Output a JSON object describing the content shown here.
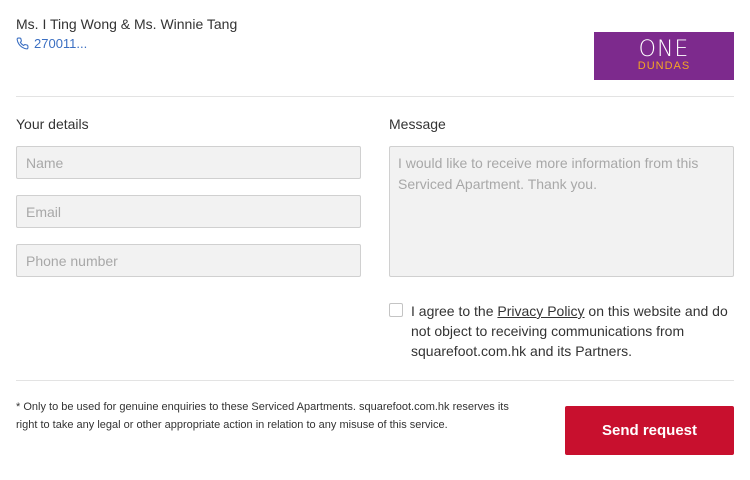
{
  "agent": {
    "name": "Ms. I Ting Wong & Ms. Winnie Tang",
    "phone": "270011..."
  },
  "logo": {
    "line1": "ONE",
    "line2": "DUNDAS",
    "bg_color": "#7d2a8d",
    "accent_color": "#f5a623"
  },
  "form": {
    "details_label": "Your details",
    "message_label": "Message",
    "name_placeholder": "Name",
    "email_placeholder": "Email",
    "phone_placeholder": "Phone number",
    "message_placeholder": "I would like to receive more information from this Serviced Apartment. Thank you."
  },
  "consent": {
    "prefix": "I agree to the ",
    "link_text": "Privacy Policy",
    "suffix": " on this website and do not object to receiving communications from squarefoot.com.hk and its Partners.",
    "checked": false
  },
  "disclaimer": "* Only to be used for genuine enquiries to these Serviced Apartments. squarefoot.com.hk reserves its right to take any legal or other appropriate action in relation to any misuse of this service.",
  "send_button": {
    "label": "Send request",
    "color": "#c8102e"
  },
  "icons": {
    "phone": "phone-icon"
  }
}
